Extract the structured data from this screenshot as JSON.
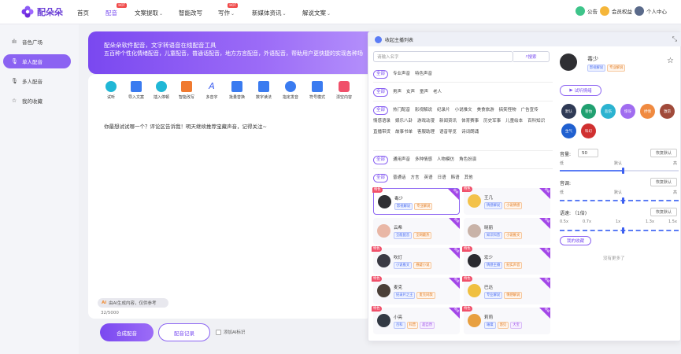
{
  "app": {
    "name": "配朵朵"
  },
  "nav": {
    "items": [
      "首页",
      "配音",
      "文案提取",
      "智能改写",
      "写作",
      "新媒体资讯",
      "解说文案"
    ],
    "hot_label": "HOT",
    "right": {
      "announce": "公告",
      "vip": "会员权益",
      "user": "个人中心"
    }
  },
  "sidebar": {
    "items": [
      "音色广场",
      "单人配音",
      "多人配音",
      "我的收藏"
    ]
  },
  "banner": {
    "line1": "配朵朵软件配音，文字转语音在线配音工具",
    "line2": "五百种个性化情绪配音，儿童配音，普通话配音，地方方言配音，外语配音，帮助用户更快捷的实现各种场"
  },
  "toolbar": {
    "items": [
      "试听",
      "导入文案",
      "插入停顿",
      "智能改写",
      "多音字",
      "批量替换",
      "数字读法",
      "指定发音",
      "符号模式",
      "漂空内容"
    ]
  },
  "editor": {
    "text": "你最想试试哪一个？评论区告诉我！明天继续推荐宝藏声音，记得关注~",
    "ai_badge": "由AI生成内容，仅供参考",
    "ai_badge_mark": "Ai",
    "counter": "32/5000"
  },
  "actions": {
    "synth": "合成配音",
    "record": "配音记录",
    "ai_mark": "添加AI标识"
  },
  "modal": {
    "title": "收起主播列表",
    "search_placeholder": "请输入名字",
    "search_btn": "搜索",
    "filters": [
      [
        "全部",
        "专业声音",
        "特色声音"
      ],
      [
        "全部",
        "男声",
        "女声",
        "童声",
        "老人"
      ],
      [
        "全部",
        "热门配音",
        "影视解说",
        "纪录片",
        "小说推文",
        "美食旅游",
        "搞笑怪物",
        "广告宣传",
        "情感语录",
        "娱乐八卦",
        "游戏动漫",
        "新闻资讯",
        "体育赛事",
        "历史军事",
        "儿童绘本",
        "百科知识",
        "直播带货",
        "故事书单",
        "客服助理",
        "语音导览",
        "诗词朗诵"
      ],
      [
        "全部",
        "通用声音",
        "多种情感",
        "人物模仿",
        "角色扮演"
      ],
      [
        "全部",
        "普通话",
        "方言",
        "英语",
        "日语",
        "韩语",
        "其他"
      ]
    ],
    "special_label": "特色",
    "corner_label": "超级",
    "voices": [
      {
        "name": "毒少",
        "tags": [
          "影视解说",
          "专业解说"
        ]
      },
      {
        "name": "王几",
        "tags": [
          "情感解说",
          "小说情感"
        ]
      },
      {
        "name": "云希",
        "tags": [
          "全能配音",
          "全网最热"
        ]
      },
      {
        "name": "晓丽",
        "tags": [
          "知识科普",
          "小说推文"
        ]
      },
      {
        "name": "吹灯",
        "tags": [
          "小说推文",
          "悬疑小说"
        ]
      },
      {
        "name": "宏少",
        "tags": [
          "情感主播",
          "纪实声音"
        ]
      },
      {
        "name": "麦克",
        "tags": [
          "纪录片之王",
          "麦克同款"
        ]
      },
      {
        "name": "巴达",
        "tags": [
          "专业解说",
          "情感解说"
        ]
      },
      {
        "name": "小亮",
        "tags": [
          "百科",
          "科普",
          "超自然"
        ]
      },
      {
        "name": "莉莉",
        "tags": [
          "璀璨",
          "悠见",
          "大宝"
        ]
      }
    ]
  },
  "panel": {
    "name": "毒少",
    "tags": [
      "影视解说",
      "专业解说"
    ],
    "emotion_btn": "试听情绪",
    "emotions": [
      "默认",
      "害怕",
      "悲伤",
      "惊讶",
      "抒情",
      "激昂",
      "生气",
      "科幻"
    ],
    "volume_label": "音量:",
    "volume_value": "50",
    "pitch_label": "音调:",
    "speed_label": "语速: （1倍)",
    "reset": "恢复默认",
    "scale_low": "低",
    "scale_default": "默认",
    "scale_high": "高",
    "speed_marks": [
      "0.5x",
      "0.7x",
      "1x",
      "1.3x",
      "1.5x"
    ],
    "my_fav": "我的收藏",
    "no_more": "没有更多了"
  },
  "colors": {
    "accent": "#7a4ef0",
    "banner_start": "#7a48f0",
    "special": "#f0506a"
  }
}
